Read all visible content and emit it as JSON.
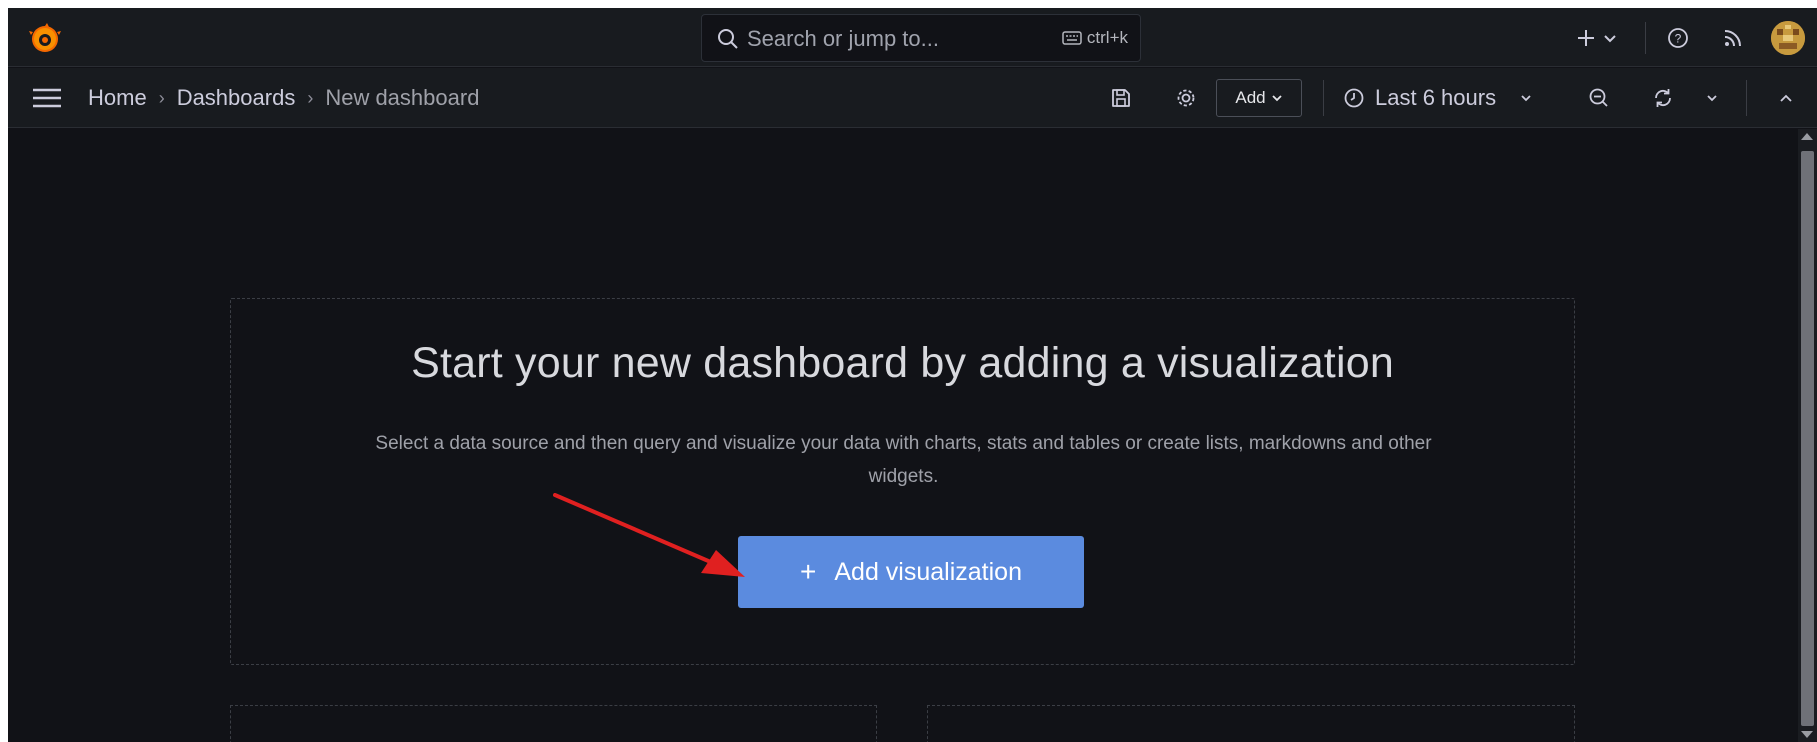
{
  "topbar": {
    "search_placeholder": "Search or jump to...",
    "search_shortcut": "ctrl+k"
  },
  "navbar": {
    "breadcrumb": [
      "Home",
      "Dashboards",
      "New dashboard"
    ],
    "add_label": "Add",
    "time_range": "Last 6 hours"
  },
  "empty_state": {
    "title": "Start your new dashboard by adding a visualization",
    "description": "Select a data source and then query and visualize your data with charts, stats and tables or create lists, markdowns and other widgets.",
    "button_label": "Add visualization"
  },
  "colors": {
    "background": "#111217",
    "bar": "#181b1f",
    "primary_button": "#5b8bdf",
    "annotation_arrow": "#e02020"
  },
  "icons": [
    "grafana-logo-icon",
    "search-icon",
    "keyboard-icon",
    "plus-icon",
    "chevron-down-icon",
    "help-icon",
    "rss-icon",
    "menu-icon",
    "save-icon",
    "gear-icon",
    "clock-icon",
    "zoom-out-icon",
    "refresh-icon",
    "chevron-up-icon"
  ]
}
